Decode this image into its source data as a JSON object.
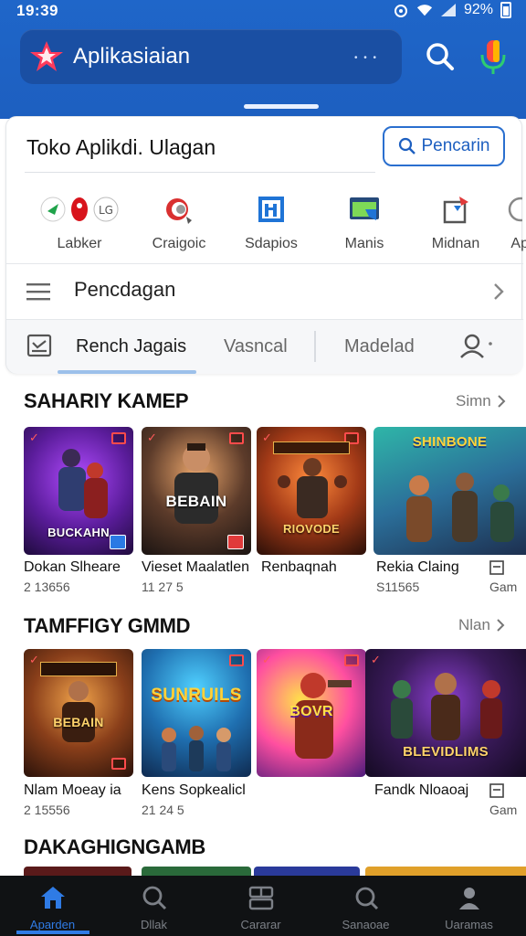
{
  "status": {
    "time": "19:39",
    "battery": "92%"
  },
  "header": {
    "app_title": "Aplikasiaian",
    "dots": "• • •"
  },
  "store": {
    "title": "Toko Aplikdi. Ulagan",
    "search_button": "Pencarin"
  },
  "categories": [
    {
      "label": "Labker",
      "icon": "multi-app-icon"
    },
    {
      "label": "Craigoic",
      "icon": "spiral-icon"
    },
    {
      "label": "Sdapios",
      "icon": "blue-square-icon"
    },
    {
      "label": "Manis",
      "icon": "monitor-icon"
    },
    {
      "label": "Midnan",
      "icon": "box-arrow-icon"
    },
    {
      "label": "Ap",
      "icon": "circle-icon"
    }
  ],
  "menu": {
    "label": "Pencdagan"
  },
  "tabs": {
    "tab1": "Rench Jagais",
    "tab2": "Vasncal",
    "tab3": "Madelad"
  },
  "sections": [
    {
      "title": "SAHARIY KAMEP",
      "more": "Simn",
      "items": [
        {
          "name": "Dokan Slheare",
          "sub": "2 13656",
          "banner": "BUCKAHN"
        },
        {
          "name": "Vieset Maalatlen",
          "sub": "11 27 5",
          "banner": "BEBAIN"
        },
        {
          "name": "Renbaqnah",
          "sub": "",
          "banner": "RIOVODE"
        },
        {
          "name": "Rekia Claing",
          "sub": "S11565",
          "banner": "SHINBONE"
        },
        {
          "name": "Gam",
          "sub": "",
          "banner": ""
        }
      ]
    },
    {
      "title": "TAMFFIGY GMMD",
      "more": "Nlan",
      "items": [
        {
          "name": "Nlam Moeay ia",
          "sub": "2 15556",
          "banner": "BEBAIN"
        },
        {
          "name": "Kens Sopkealicl",
          "sub": "21 24 5",
          "banner": "SUNRUILS"
        },
        {
          "name": "",
          "sub": "",
          "banner": "BOVR"
        },
        {
          "name": "Fandk Nloaoaj",
          "sub": "",
          "banner": "BLEVIDLIMS"
        },
        {
          "name": "Gam",
          "sub": "",
          "banner": ""
        }
      ]
    },
    {
      "title": "DAKAGHIGNGAMB"
    }
  ],
  "bottom_nav": [
    {
      "label": "Aparden",
      "active": true
    },
    {
      "label": "Dllak",
      "active": false
    },
    {
      "label": "Cararar",
      "active": false
    },
    {
      "label": "Sanaoae",
      "active": false
    },
    {
      "label": "Uaramas",
      "active": false
    }
  ],
  "colors": {
    "primary": "#1f66c9",
    "accent": "#2f7be5",
    "nav_bg": "#101214"
  }
}
